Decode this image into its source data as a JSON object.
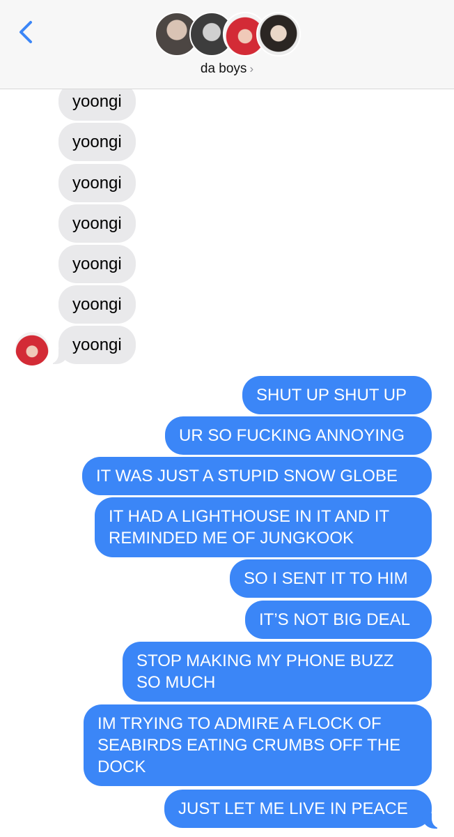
{
  "header": {
    "group_name": "da boys",
    "chevron": "›",
    "back_icon": "chevron-left-icon",
    "accent": "#3b86f7"
  },
  "incoming": [
    {
      "text": "yoongi"
    },
    {
      "text": "yoongi"
    },
    {
      "text": "yoongi"
    },
    {
      "text": "yoongi"
    },
    {
      "text": "yoongi"
    },
    {
      "text": "yoongi"
    },
    {
      "text": "yoongi"
    }
  ],
  "outgoing": [
    {
      "text": "SHUT UP SHUT UP"
    },
    {
      "text": "UR SO FUCKING ANNOYING"
    },
    {
      "text": "IT WAS JUST A STUPID SNOW GLOBE"
    },
    {
      "text": "IT HAD A LIGHTHOUSE IN IT AND IT REMINDED ME OF JUNGKOOK"
    },
    {
      "text": "SO I SENT IT TO HIM"
    },
    {
      "text": "IT’S NOT BIG DEAL"
    },
    {
      "text": "STOP MAKING MY PHONE BUZZ SO MUCH"
    },
    {
      "text": "IM TRYING TO ADMIRE A FLOCK OF SEABIRDS EATING CRUMBS OFF THE DOCK"
    },
    {
      "text": "JUST LET ME LIVE IN PEACE"
    }
  ],
  "colors": {
    "incoming_bubble": "#e9e9eb",
    "outgoing_bubble": "#3b86f7",
    "header_bg": "#f7f7f7"
  }
}
